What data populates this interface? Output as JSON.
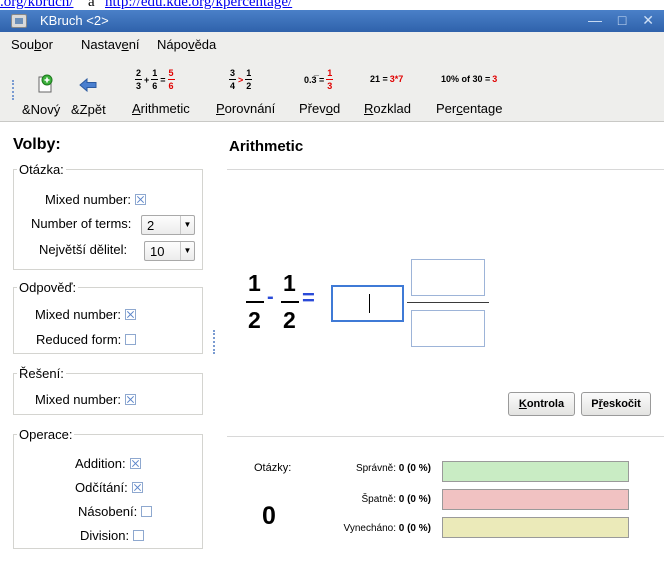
{
  "browser": {
    "frag1": ".org/kbruch/",
    "frag2": " a ",
    "frag3": "http://edu.kde.org/kpercentage/"
  },
  "window": {
    "title": "KBruch <2>",
    "controls": "— □ ✕"
  },
  "menubar": {
    "items": [
      {
        "pre": "Sou",
        "acc": "b",
        "post": "or"
      },
      {
        "pre": "Nastav",
        "acc": "e",
        "post": "ní"
      },
      {
        "pre": "Nápo",
        "acc": "v",
        "post": "ěda"
      }
    ]
  },
  "toolbar": {
    "new_label": "&Nový",
    "back_label": "&Zpět",
    "modes": [
      {
        "pre": "",
        "acc": "A",
        "post": "rithmetic"
      },
      {
        "pre": "",
        "acc": "P",
        "post": "orovnání"
      },
      {
        "pre": "Přev",
        "acc": "o",
        "post": "d"
      },
      {
        "pre": "",
        "acc": "R",
        "post": "ozklad"
      },
      {
        "pre": "Per",
        "acc": "c",
        "post": "entage"
      }
    ],
    "icons": {
      "arith": {
        "n1": "2",
        "d1": "3",
        "op": "+",
        "n2": "1",
        "d2": "6",
        "eq": "=",
        "n3": "5",
        "d3": "6"
      },
      "compare": {
        "n1": "3",
        "d1": "4",
        "op": ">",
        "n2": "1",
        "d2": "2"
      },
      "convert": {
        "left": "0.3̅ =",
        "n": "1",
        "d": "3"
      },
      "factor": {
        "left": "21 =",
        "right": "3*7"
      },
      "percent": {
        "left": "10% of 30 =",
        "right": "3"
      }
    }
  },
  "options": {
    "title": "Volby:",
    "question": {
      "title": "Otázka:",
      "mixed_label": "Mixed number:",
      "mixed_checked": true,
      "terms_label": "Number of terms:",
      "terms_value": "2",
      "divisor_label": "Největší dělitel:",
      "divisor_value": "10"
    },
    "answer": {
      "title": "Odpověď:",
      "mixed_label": "Mixed number:",
      "mixed_checked": true,
      "reduced_label": "Reduced form:",
      "reduced_checked": false
    },
    "solution": {
      "title": "Řešení:",
      "mixed_label": "Mixed number:",
      "mixed_checked": true
    },
    "operations": {
      "title": "Operace:",
      "addition": "Addition:",
      "addition_checked": true,
      "subtraction": "Odčítání:",
      "subtraction_checked": true,
      "multiplication": "Násobení:",
      "multiplication_checked": false,
      "division": "Division:",
      "division_checked": false
    }
  },
  "task": {
    "title": "Arithmetic",
    "n1": "1",
    "d1": "2",
    "op": "-",
    "n2": "1",
    "d2": "2",
    "eq": "="
  },
  "buttons": {
    "check": {
      "pre": "",
      "acc": "K",
      "post": "ontrola"
    },
    "skip": {
      "pre": "P",
      "acc": "ř",
      "post": "eskočit"
    }
  },
  "stats": {
    "questions_label": "Otázky:",
    "questions_count": "0",
    "correct_label": "Správně:",
    "correct_value": "0 (0 %)",
    "wrong_label": "Špatně:",
    "wrong_value": "0 (0 %)",
    "skipped_label": "Vynecháno:",
    "skipped_value": "0 (0 %)",
    "colors": {
      "correct": "#c9ecc4",
      "wrong": "#f1c2c2",
      "skipped": "#ebeab9"
    }
  }
}
